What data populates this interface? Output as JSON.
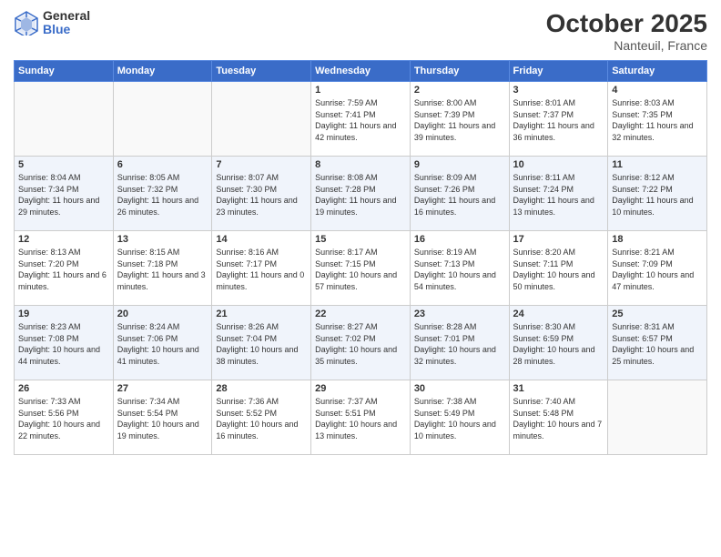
{
  "header": {
    "logo_general": "General",
    "logo_blue": "Blue",
    "month": "October 2025",
    "location": "Nanteuil, France"
  },
  "weekdays": [
    "Sunday",
    "Monday",
    "Tuesday",
    "Wednesday",
    "Thursday",
    "Friday",
    "Saturday"
  ],
  "weeks": [
    [
      {
        "day": "",
        "sunrise": "",
        "sunset": "",
        "daylight": ""
      },
      {
        "day": "",
        "sunrise": "",
        "sunset": "",
        "daylight": ""
      },
      {
        "day": "",
        "sunrise": "",
        "sunset": "",
        "daylight": ""
      },
      {
        "day": "1",
        "sunrise": "Sunrise: 7:59 AM",
        "sunset": "Sunset: 7:41 PM",
        "daylight": "Daylight: 11 hours and 42 minutes."
      },
      {
        "day": "2",
        "sunrise": "Sunrise: 8:00 AM",
        "sunset": "Sunset: 7:39 PM",
        "daylight": "Daylight: 11 hours and 39 minutes."
      },
      {
        "day": "3",
        "sunrise": "Sunrise: 8:01 AM",
        "sunset": "Sunset: 7:37 PM",
        "daylight": "Daylight: 11 hours and 36 minutes."
      },
      {
        "day": "4",
        "sunrise": "Sunrise: 8:03 AM",
        "sunset": "Sunset: 7:35 PM",
        "daylight": "Daylight: 11 hours and 32 minutes."
      }
    ],
    [
      {
        "day": "5",
        "sunrise": "Sunrise: 8:04 AM",
        "sunset": "Sunset: 7:34 PM",
        "daylight": "Daylight: 11 hours and 29 minutes."
      },
      {
        "day": "6",
        "sunrise": "Sunrise: 8:05 AM",
        "sunset": "Sunset: 7:32 PM",
        "daylight": "Daylight: 11 hours and 26 minutes."
      },
      {
        "day": "7",
        "sunrise": "Sunrise: 8:07 AM",
        "sunset": "Sunset: 7:30 PM",
        "daylight": "Daylight: 11 hours and 23 minutes."
      },
      {
        "day": "8",
        "sunrise": "Sunrise: 8:08 AM",
        "sunset": "Sunset: 7:28 PM",
        "daylight": "Daylight: 11 hours and 19 minutes."
      },
      {
        "day": "9",
        "sunrise": "Sunrise: 8:09 AM",
        "sunset": "Sunset: 7:26 PM",
        "daylight": "Daylight: 11 hours and 16 minutes."
      },
      {
        "day": "10",
        "sunrise": "Sunrise: 8:11 AM",
        "sunset": "Sunset: 7:24 PM",
        "daylight": "Daylight: 11 hours and 13 minutes."
      },
      {
        "day": "11",
        "sunrise": "Sunrise: 8:12 AM",
        "sunset": "Sunset: 7:22 PM",
        "daylight": "Daylight: 11 hours and 10 minutes."
      }
    ],
    [
      {
        "day": "12",
        "sunrise": "Sunrise: 8:13 AM",
        "sunset": "Sunset: 7:20 PM",
        "daylight": "Daylight: 11 hours and 6 minutes."
      },
      {
        "day": "13",
        "sunrise": "Sunrise: 8:15 AM",
        "sunset": "Sunset: 7:18 PM",
        "daylight": "Daylight: 11 hours and 3 minutes."
      },
      {
        "day": "14",
        "sunrise": "Sunrise: 8:16 AM",
        "sunset": "Sunset: 7:17 PM",
        "daylight": "Daylight: 11 hours and 0 minutes."
      },
      {
        "day": "15",
        "sunrise": "Sunrise: 8:17 AM",
        "sunset": "Sunset: 7:15 PM",
        "daylight": "Daylight: 10 hours and 57 minutes."
      },
      {
        "day": "16",
        "sunrise": "Sunrise: 8:19 AM",
        "sunset": "Sunset: 7:13 PM",
        "daylight": "Daylight: 10 hours and 54 minutes."
      },
      {
        "day": "17",
        "sunrise": "Sunrise: 8:20 AM",
        "sunset": "Sunset: 7:11 PM",
        "daylight": "Daylight: 10 hours and 50 minutes."
      },
      {
        "day": "18",
        "sunrise": "Sunrise: 8:21 AM",
        "sunset": "Sunset: 7:09 PM",
        "daylight": "Daylight: 10 hours and 47 minutes."
      }
    ],
    [
      {
        "day": "19",
        "sunrise": "Sunrise: 8:23 AM",
        "sunset": "Sunset: 7:08 PM",
        "daylight": "Daylight: 10 hours and 44 minutes."
      },
      {
        "day": "20",
        "sunrise": "Sunrise: 8:24 AM",
        "sunset": "Sunset: 7:06 PM",
        "daylight": "Daylight: 10 hours and 41 minutes."
      },
      {
        "day": "21",
        "sunrise": "Sunrise: 8:26 AM",
        "sunset": "Sunset: 7:04 PM",
        "daylight": "Daylight: 10 hours and 38 minutes."
      },
      {
        "day": "22",
        "sunrise": "Sunrise: 8:27 AM",
        "sunset": "Sunset: 7:02 PM",
        "daylight": "Daylight: 10 hours and 35 minutes."
      },
      {
        "day": "23",
        "sunrise": "Sunrise: 8:28 AM",
        "sunset": "Sunset: 7:01 PM",
        "daylight": "Daylight: 10 hours and 32 minutes."
      },
      {
        "day": "24",
        "sunrise": "Sunrise: 8:30 AM",
        "sunset": "Sunset: 6:59 PM",
        "daylight": "Daylight: 10 hours and 28 minutes."
      },
      {
        "day": "25",
        "sunrise": "Sunrise: 8:31 AM",
        "sunset": "Sunset: 6:57 PM",
        "daylight": "Daylight: 10 hours and 25 minutes."
      }
    ],
    [
      {
        "day": "26",
        "sunrise": "Sunrise: 7:33 AM",
        "sunset": "Sunset: 5:56 PM",
        "daylight": "Daylight: 10 hours and 22 minutes."
      },
      {
        "day": "27",
        "sunrise": "Sunrise: 7:34 AM",
        "sunset": "Sunset: 5:54 PM",
        "daylight": "Daylight: 10 hours and 19 minutes."
      },
      {
        "day": "28",
        "sunrise": "Sunrise: 7:36 AM",
        "sunset": "Sunset: 5:52 PM",
        "daylight": "Daylight: 10 hours and 16 minutes."
      },
      {
        "day": "29",
        "sunrise": "Sunrise: 7:37 AM",
        "sunset": "Sunset: 5:51 PM",
        "daylight": "Daylight: 10 hours and 13 minutes."
      },
      {
        "day": "30",
        "sunrise": "Sunrise: 7:38 AM",
        "sunset": "Sunset: 5:49 PM",
        "daylight": "Daylight: 10 hours and 10 minutes."
      },
      {
        "day": "31",
        "sunrise": "Sunrise: 7:40 AM",
        "sunset": "Sunset: 5:48 PM",
        "daylight": "Daylight: 10 hours and 7 minutes."
      },
      {
        "day": "",
        "sunrise": "",
        "sunset": "",
        "daylight": ""
      }
    ]
  ]
}
